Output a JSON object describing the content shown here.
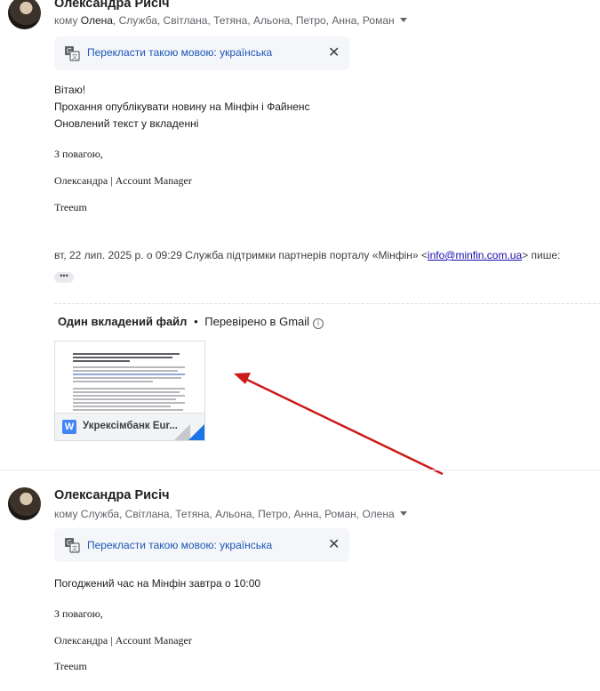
{
  "message1": {
    "sender": "Олександра Рисіч",
    "recipients_prefix": "кому ",
    "recipients_first": "Олена",
    "recipients_rest": ", Служба, Світлана, Тетяна, Альона, Петро, Анна, Роман",
    "translate_label": "Перекласти такою мовою: українська",
    "body": [
      "Вітаю!",
      "Прохання опублікувати новину на Мінфін і Файненс",
      "Оновлений текст у вкладенні"
    ],
    "signature": {
      "regards": "З повагою,",
      "name": "Олександра | Account Manager",
      "company": "Treeum"
    },
    "quote_prefix": "вт, 22 лип. 2025 р. о 09:29 Служба підтримки партнерів порталу «Мінфін» <",
    "quote_email": "info@minfin.com.ua",
    "quote_suffix": "> пише:",
    "attachments_title": "Один вкладений файл",
    "attachments_separator": "•",
    "attachments_verified": "Перевірено в Gmail",
    "attachment_name": "Укрексімбанк Eur..."
  },
  "message2": {
    "sender": "Олександра Рисіч",
    "recipients_prefix": "кому ",
    "recipients": "Служба, Світлана, Тетяна, Альона, Петро, Анна, Роман, Олена",
    "translate_label": "Перекласти такою мовою: українська",
    "body": [
      "Погоджений час на Мінфін завтра о 10:00"
    ],
    "signature": {
      "regards": "З повагою,",
      "name": "Олександра | Account Manager",
      "company": "Treeum"
    }
  },
  "icons": {
    "translate": "translate-icon",
    "close": "close-icon",
    "more": "ellipsis-icon",
    "info": "info-icon",
    "doc": "word-doc-icon",
    "caret": "chevron-down-icon"
  },
  "colors": {
    "link": "#1a56b7",
    "arrow": "#cc1a1a",
    "word": "#4285f4"
  }
}
